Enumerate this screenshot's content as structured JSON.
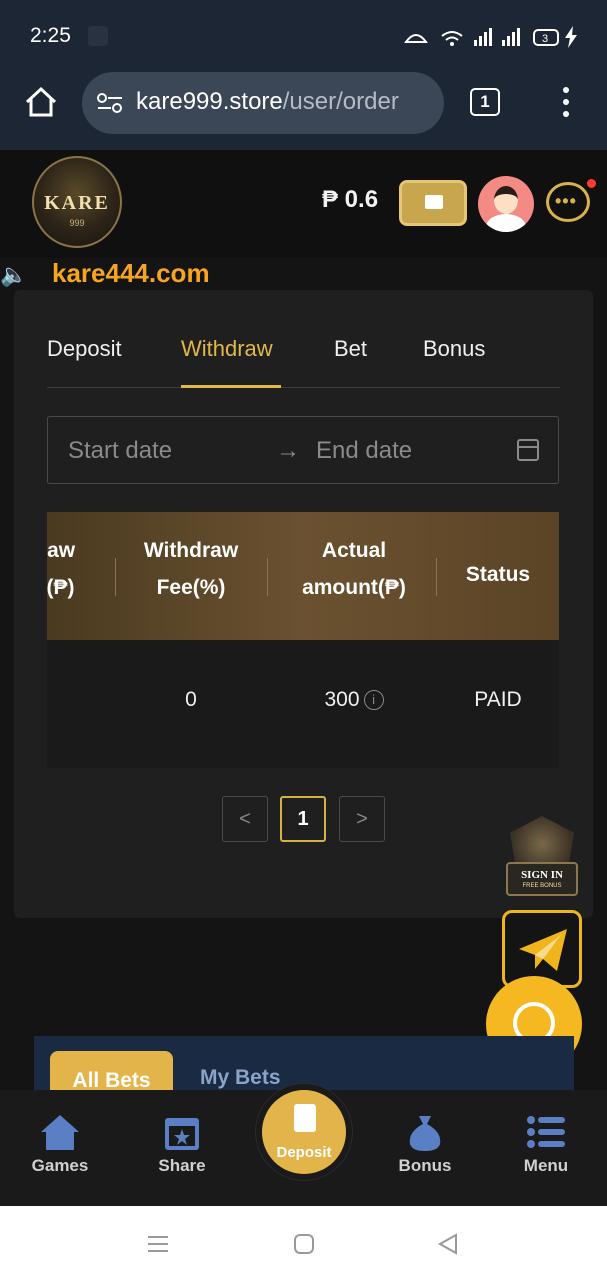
{
  "status_bar": {
    "time": "2:25",
    "battery": "3"
  },
  "browser": {
    "url_domain": "kare999.store",
    "url_path": "/user/order",
    "tab_count": "1"
  },
  "header": {
    "logo_text": "KARE",
    "logo_sub": "999",
    "balance": "₱ 0.6"
  },
  "marquee": {
    "text": "kare444.com"
  },
  "tabs": [
    {
      "label": "Deposit",
      "active": false
    },
    {
      "label": "Withdraw",
      "active": true
    },
    {
      "label": "Bet",
      "active": false
    },
    {
      "label": "Bonus",
      "active": false
    }
  ],
  "date_range": {
    "start_placeholder": "Start date",
    "arrow": "→",
    "end_placeholder": "End date"
  },
  "table": {
    "columns": [
      {
        "line1": "raw",
        "line2": "t(₱)"
      },
      {
        "line1": "Withdraw",
        "line2": "Fee(%)"
      },
      {
        "line1": "Actual",
        "line2": "amount(₱)"
      },
      {
        "line1": "Status",
        "line2": ""
      }
    ],
    "rows": [
      {
        "amount": "",
        "fee": "0",
        "actual": "300",
        "status": "PAID"
      }
    ]
  },
  "pagination": {
    "prev": "<",
    "current": "1",
    "next": ">"
  },
  "floating": {
    "signin_title": "SIGN IN",
    "signin_sub": "FREE BONUS"
  },
  "bets": {
    "all_bets": "All Bets",
    "my_bets": "My Bets"
  },
  "bottom_nav": [
    {
      "label": "Games",
      "icon": "home-icon"
    },
    {
      "label": "Share",
      "icon": "calendar-star-icon"
    },
    {
      "label": "Deposit",
      "icon": "wallet-icon"
    },
    {
      "label": "Bonus",
      "icon": "money-bag-icon"
    },
    {
      "label": "Menu",
      "icon": "list-icon"
    }
  ],
  "colors": {
    "accent": "#e0b84c",
    "marquee": "#f7a51f",
    "bg": "#141414",
    "card": "#1f1f1f"
  }
}
